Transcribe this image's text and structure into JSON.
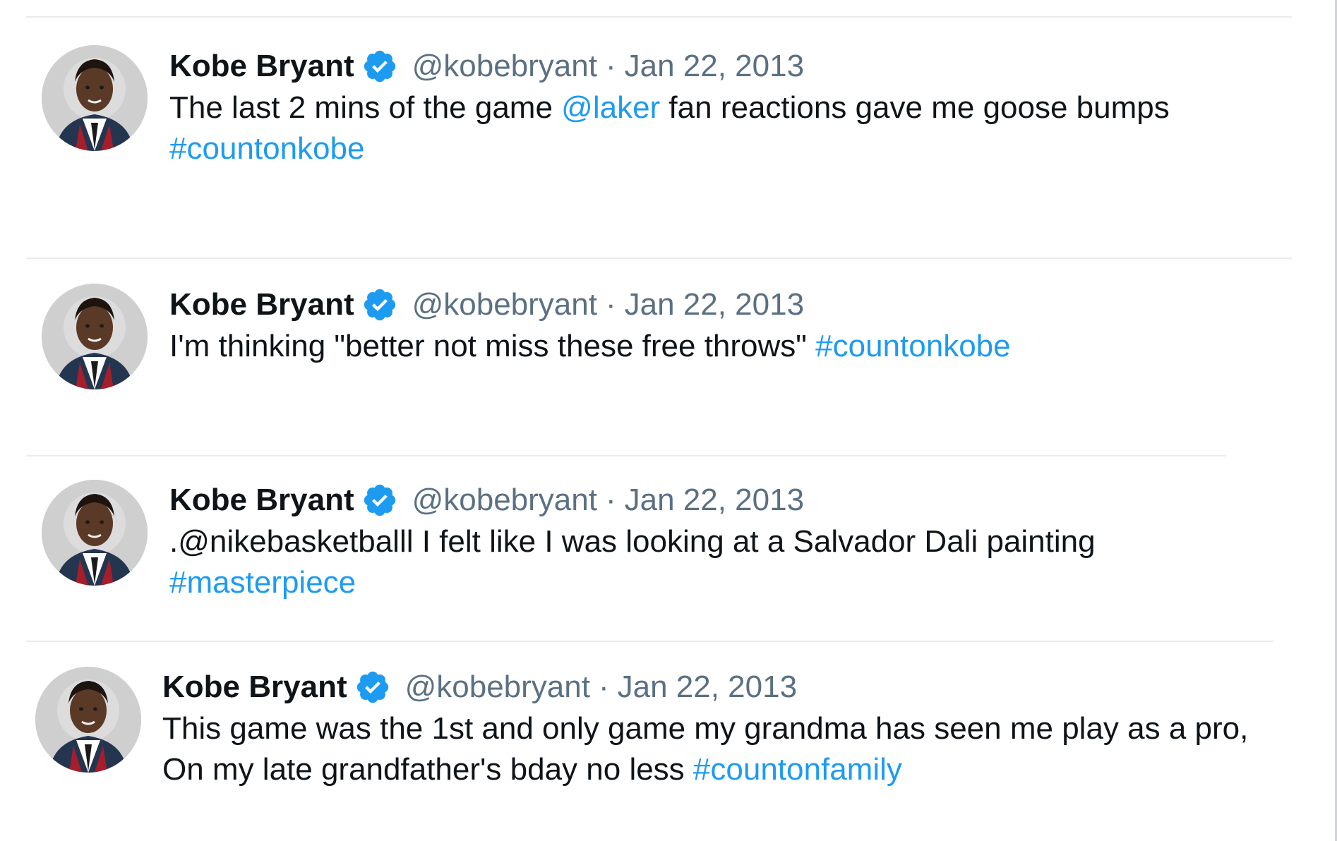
{
  "tweets": [
    {
      "name": "Kobe Bryant",
      "handle": "@kobebryant",
      "separator": "·",
      "date": "Jan 22, 2013",
      "segments": [
        {
          "text": "The last 2 mins of the game ",
          "link": false
        },
        {
          "text": "@laker",
          "link": true
        },
        {
          "text": " fan reactions gave me goose bumps ",
          "link": false
        },
        {
          "text": "#countonkobe",
          "link": true
        }
      ]
    },
    {
      "name": "Kobe Bryant",
      "handle": "@kobebryant",
      "separator": "·",
      "date": "Jan 22, 2013",
      "segments": [
        {
          "text": "I'm thinking \"better not miss these free throws\" ",
          "link": false
        },
        {
          "text": "#countonkobe",
          "link": true
        }
      ]
    },
    {
      "name": "Kobe Bryant",
      "handle": "@kobebryant",
      "separator": "·",
      "date": "Jan 22, 2013",
      "segments": [
        {
          "text": ".@nikebasketballl I felt like I was looking at a Salvador Dali painting ",
          "link": false
        },
        {
          "text": "#masterpiece",
          "link": true
        }
      ]
    },
    {
      "name": "Kobe Bryant",
      "handle": "@kobebryant",
      "separator": "·",
      "date": "Jan 22, 2013",
      "segments": [
        {
          "text": "This game was the 1st and only game my grandma has seen me play as a pro, On my late grandfather's bday no less ",
          "link": false
        },
        {
          "text": "#countonfamily",
          "link": true
        }
      ]
    }
  ],
  "icons": {
    "verified": "verified-badge-icon",
    "avatar": "profile-avatar"
  },
  "colors": {
    "link": "#1d9bf0",
    "secondary_text": "#5b7083",
    "primary_text": "#0f1419",
    "divider": "#e8ecef"
  }
}
